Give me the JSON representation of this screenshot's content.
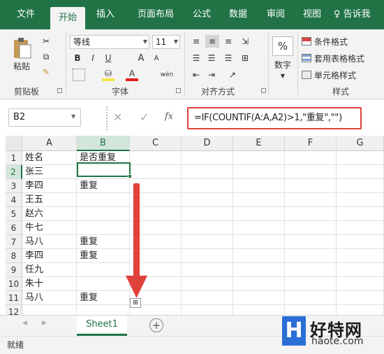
{
  "tabs": [
    {
      "label": "文件"
    },
    {
      "label": "开始"
    },
    {
      "label": "插入"
    },
    {
      "label": "页面布局"
    },
    {
      "label": "公式"
    },
    {
      "label": "数据"
    },
    {
      "label": "审阅"
    },
    {
      "label": "视图"
    },
    {
      "label": "告诉我"
    }
  ],
  "ribbon": {
    "clipboard": {
      "paste_label": "粘贴",
      "group_label": "剪贴板"
    },
    "font": {
      "name": "等线",
      "size": "11",
      "bold": "B",
      "italic": "I",
      "underline": "U",
      "grow": "A",
      "shrink": "A",
      "color": "A",
      "phonetic": "wén",
      "group_label": "字体"
    },
    "alignment": {
      "group_label": "对齐方式"
    },
    "number": {
      "symbol": "%",
      "label": "数字"
    },
    "styles": {
      "conditional": "条件格式",
      "table": "套用表格格式",
      "cell": "单元格样式",
      "group_label": "样式"
    }
  },
  "formula_bar": {
    "name_box": "B2",
    "cancel": "✕",
    "enter": "✓",
    "fx": "fx",
    "formula": "=IF(COUNTIF(A:A,A2)>1,\"重复\",\"\")"
  },
  "columns": [
    "A",
    "B",
    "C",
    "D",
    "E",
    "F",
    "G"
  ],
  "rows": [
    {
      "num": "1",
      "a": "姓名",
      "b": "是否重复"
    },
    {
      "num": "2",
      "a": "张三",
      "b": ""
    },
    {
      "num": "3",
      "a": "李四",
      "b": "重复"
    },
    {
      "num": "4",
      "a": "王五",
      "b": ""
    },
    {
      "num": "5",
      "a": "赵六",
      "b": ""
    },
    {
      "num": "6",
      "a": "牛七",
      "b": ""
    },
    {
      "num": "7",
      "a": "马八",
      "b": "重复"
    },
    {
      "num": "8",
      "a": "李四",
      "b": "重复"
    },
    {
      "num": "9",
      "a": "任九",
      "b": ""
    },
    {
      "num": "10",
      "a": "朱十",
      "b": ""
    },
    {
      "num": "11",
      "a": "马八",
      "b": "重复"
    },
    {
      "num": "12",
      "a": "",
      "b": ""
    }
  ],
  "sheet_tab": "Sheet1",
  "add_sheet": "+",
  "status": "就绪",
  "watermark": {
    "logo_letter": "H",
    "name": "好特网",
    "url": "haote.com"
  },
  "colors": {
    "accent": "#217346",
    "highlight": "#e0413a"
  }
}
